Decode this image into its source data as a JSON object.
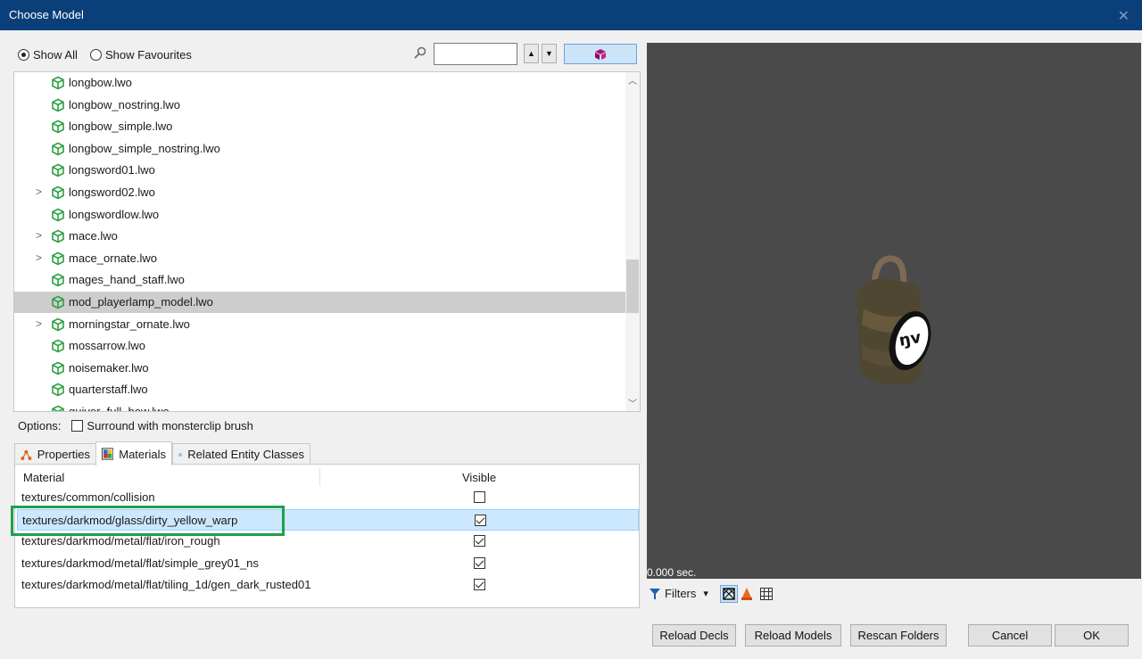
{
  "window": {
    "title": "Choose Model",
    "close_glyph": "✕"
  },
  "filter": {
    "show_all_label": "Show All",
    "show_all_selected": true,
    "show_favourites_label": "Show Favourites",
    "show_favourites_selected": false,
    "search_value": "",
    "search_placeholder": "",
    "up_glyph": "▲",
    "down_glyph": "▼"
  },
  "tree": {
    "items": [
      {
        "label": "longbow.lwo",
        "expandable": false,
        "selected": false
      },
      {
        "label": "longbow_nostring.lwo",
        "expandable": false,
        "selected": false
      },
      {
        "label": "longbow_simple.lwo",
        "expandable": false,
        "selected": false
      },
      {
        "label": "longbow_simple_nostring.lwo",
        "expandable": false,
        "selected": false
      },
      {
        "label": "longsword01.lwo",
        "expandable": false,
        "selected": false
      },
      {
        "label": "longsword02.lwo",
        "expandable": true,
        "selected": false
      },
      {
        "label": "longswordlow.lwo",
        "expandable": false,
        "selected": false
      },
      {
        "label": "mace.lwo",
        "expandable": true,
        "selected": false
      },
      {
        "label": "mace_ornate.lwo",
        "expandable": true,
        "selected": false
      },
      {
        "label": "mages_hand_staff.lwo",
        "expandable": false,
        "selected": false
      },
      {
        "label": "mod_playerlamp_model.lwo",
        "expandable": false,
        "selected": true
      },
      {
        "label": "morningstar_ornate.lwo",
        "expandable": true,
        "selected": false
      },
      {
        "label": "mossarrow.lwo",
        "expandable": false,
        "selected": false
      },
      {
        "label": "noisemaker.lwo",
        "expandable": false,
        "selected": false
      },
      {
        "label": "quarterstaff.lwo",
        "expandable": false,
        "selected": false
      },
      {
        "label": "quiver_full_bow.lwo",
        "expandable": false,
        "selected": false
      }
    ],
    "expand_glyph": ">",
    "scroll_up_glyph": "︿",
    "scroll_down_glyph": "﹀"
  },
  "options": {
    "label": "Options:",
    "monsterclip_label": "Surround with monsterclip brush",
    "monsterclip_checked": false
  },
  "tabs": [
    {
      "label": "Properties",
      "icon": "properties-icon",
      "active": false
    },
    {
      "label": "Materials",
      "icon": "materials-icon",
      "active": true
    },
    {
      "label": "Related Entity Classes",
      "icon": "entity-classes-icon",
      "active": false
    }
  ],
  "materials": {
    "col_material": "Material",
    "col_visible": "Visible",
    "rows": [
      {
        "name": "textures/common/collision",
        "visible": false,
        "selected": false
      },
      {
        "name": "textures/darkmod/glass/dirty_yellow_warp",
        "visible": true,
        "selected": true
      },
      {
        "name": "textures/darkmod/metal/flat/iron_rough",
        "visible": true,
        "selected": false
      },
      {
        "name": "textures/darkmod/metal/flat/simple_grey01_ns",
        "visible": true,
        "selected": false
      },
      {
        "name": "textures/darkmod/metal/flat/tiling_1d/gen_dark_rusted01",
        "visible": true,
        "selected": false
      }
    ]
  },
  "preview": {
    "render_time": "0.000 sec.",
    "filters_label": "Filters",
    "dropdown_glyph": "▾"
  },
  "buttons": {
    "reload_decls": "Reload Decls",
    "reload_models": "Reload Models",
    "rescan_folders": "Rescan Folders",
    "cancel": "Cancel",
    "ok": "OK"
  },
  "colors": {
    "titlebar": "#0b3f7a",
    "model_icon_green": "#2ea043",
    "selection_highlight": "#1fa049",
    "viewport_bg": "#4a4a4a"
  }
}
